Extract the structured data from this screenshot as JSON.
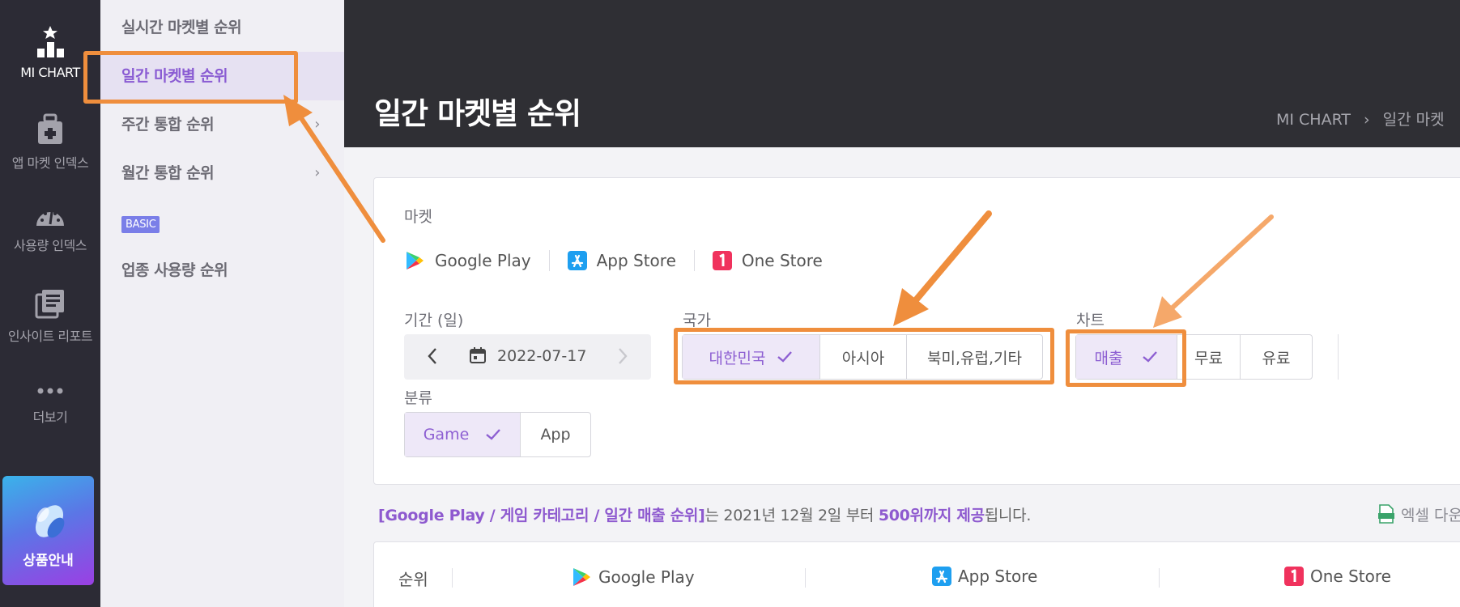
{
  "rail": {
    "items": [
      {
        "label": "MI CHART",
        "icon": "chart-star-icon",
        "active": true
      },
      {
        "label": "앱 마켓 인덱스",
        "icon": "bag-icon"
      },
      {
        "label": "사용량 인덱스",
        "icon": "gauge-icon"
      },
      {
        "label": "인사이트 리포트",
        "icon": "report-icon"
      },
      {
        "label": "더보기",
        "icon": "more-dots-icon"
      }
    ],
    "promo_label": "상품안내"
  },
  "submenu": {
    "items": [
      {
        "label": "실시간 마켓별 순위"
      },
      {
        "label": "일간 마켓별 순위",
        "active": true
      },
      {
        "label": "주간 통합 순위",
        "chevron": "›"
      },
      {
        "label": "월간 통합 순위",
        "chevron": "›"
      },
      {
        "label": "업종 사용량 순위"
      }
    ],
    "badge": "BASIC"
  },
  "header": {
    "title": "일간 마켓별 순위",
    "breadcrumb": [
      "MI CHART",
      "일간 마켓"
    ]
  },
  "filters": {
    "market_label": "마켓",
    "markets": [
      {
        "label": "Google Play",
        "icon": "google-play-icon"
      },
      {
        "label": "App Store",
        "icon": "app-store-icon"
      },
      {
        "label": "One Store",
        "icon": "one-store-icon"
      }
    ],
    "period_label": "기간 (일)",
    "date": "2022-07-17",
    "country_label": "국가",
    "countries": [
      {
        "label": "대한민국",
        "selected": true
      },
      {
        "label": "아시아"
      },
      {
        "label": "북미,유럽,기타"
      }
    ],
    "chart_label": "차트",
    "chart_types": [
      {
        "label": "매출",
        "selected": true
      },
      {
        "label": "무료"
      },
      {
        "label": "유료"
      }
    ],
    "category_label": "분류",
    "categories": [
      {
        "label": "Game",
        "selected": true
      },
      {
        "label": "App"
      }
    ]
  },
  "info": {
    "highlight": "[Google Play / 게임 카테고리 / 일간 매출 순위]",
    "middle": "는 2021년 12월 2일 부터 ",
    "bold": "500위까지 제공",
    "tail": "됩니다.",
    "excel": "엑셀 다운"
  },
  "table": {
    "rank_header": "순위",
    "columns": [
      "Google Play",
      "App Store",
      "One Store"
    ]
  },
  "colors": {
    "accent": "#8d5fd2",
    "highlight_box": "#ef8e3d",
    "rail_bg": "#2c2b35",
    "topbar_bg": "#2f2f34"
  }
}
